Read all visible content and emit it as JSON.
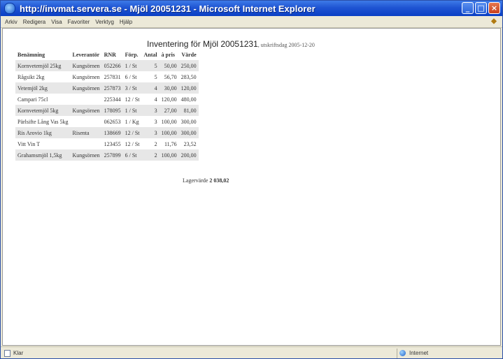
{
  "window": {
    "title": "http://invmat.servera.se - Mjöl 20051231 - Microsoft Internet Explorer",
    "buttons": {
      "minimize": "_",
      "maximize": "□",
      "close": "×"
    }
  },
  "menu": {
    "items": [
      "Arkiv",
      "Redigera",
      "Visa",
      "Favoriter",
      "Verktyg",
      "Hjälp"
    ]
  },
  "report": {
    "title": "Inventering för Mjöl 20051231",
    "subtitle": ", utskriftsdag 2005-12-20",
    "columns": {
      "name": "Benämning",
      "supplier": "Leverantör",
      "number": "RNR",
      "package": "Förp.",
      "quantity": "Antal",
      "price": "à pris",
      "value": "Värde"
    },
    "rows": [
      {
        "name": "Kornvetemjöl 25kg",
        "supplier": "Kungsörnen",
        "number": "052266",
        "package": "1 / St",
        "quantity": "5",
        "price": "50,00",
        "value": "250,00"
      },
      {
        "name": "Rågsikt 2kg",
        "supplier": "Kungsörnen",
        "number": "257831",
        "package": "6 / St",
        "quantity": "5",
        "price": "56,70",
        "value": "283,50"
      },
      {
        "name": "Vetemjöl 2kg",
        "supplier": "Kungsörnen",
        "number": "257873",
        "package": "3 / St",
        "quantity": "4",
        "price": "30,00",
        "value": "120,00"
      },
      {
        "name": "Campari 75cl",
        "supplier": "",
        "number": "225344",
        "package": "12 / St",
        "quantity": "4",
        "price": "120,00",
        "value": "480,00"
      },
      {
        "name": "Kornvetemjöl 5kg",
        "supplier": "Kungsörnen",
        "number": "178095",
        "package": "1 / St",
        "quantity": "3",
        "price": "27,00",
        "value": "81,00"
      },
      {
        "name": "Pärlsifte Lång Vas 5kg",
        "supplier": "",
        "number": "062653",
        "package": "1 / Kg",
        "quantity": "3",
        "price": "100,00",
        "value": "300,00"
      },
      {
        "name": "Ris Arovio 1kg",
        "supplier": "Risenta",
        "number": "138669",
        "package": "12 / St",
        "quantity": "3",
        "price": "100,00",
        "value": "300,00"
      },
      {
        "name": "Vitt Vin T",
        "supplier": "",
        "number": "123455",
        "package": "12 / St",
        "quantity": "2",
        "price": "11,76",
        "value": "23,52"
      },
      {
        "name": "Grahamsmjöl 1,5kg",
        "supplier": "Kungsörnen",
        "number": "257899",
        "package": "6 / St",
        "quantity": "2",
        "price": "100,00",
        "value": "200,00"
      }
    ],
    "total_label": "Lagervärde",
    "total_value": "2 038,02"
  },
  "status": {
    "left": "Klar",
    "zone": "Internet"
  }
}
